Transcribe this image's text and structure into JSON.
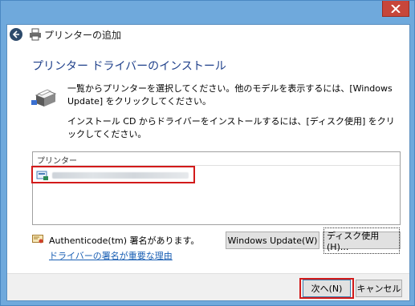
{
  "window": {
    "title": "プリンターの追加"
  },
  "page": {
    "heading": "プリンター ドライバーのインストール",
    "instruction_1": "一覧からプリンターを選択してください。他のモデルを表示するには、[Windows Update] をクリックしてください。",
    "instruction_2": "インストール CD からドライバーをインストールするには、[ディスク使用] をクリックしてください。"
  },
  "printer_list": {
    "header": "プリンター"
  },
  "certificate": {
    "status_text": "Authenticode(tm) 署名があります。",
    "link_text": "ドライバーの署名が重要な理由"
  },
  "buttons": {
    "windows_update": "Windows Update(W)",
    "have_disk": "ディスク使用(H)...",
    "next": "次へ(N)",
    "cancel": "キャンセル"
  },
  "colors": {
    "title_bar": "#6fa9dc",
    "heading": "#1e3f8a",
    "link": "#1a5fb4",
    "highlight": "#d21a1a",
    "close_button": "#c7463a"
  },
  "icons": {
    "close": "close-icon",
    "back": "back-arrow-icon",
    "printer": "printer-icon",
    "certificate": "certificate-icon"
  }
}
